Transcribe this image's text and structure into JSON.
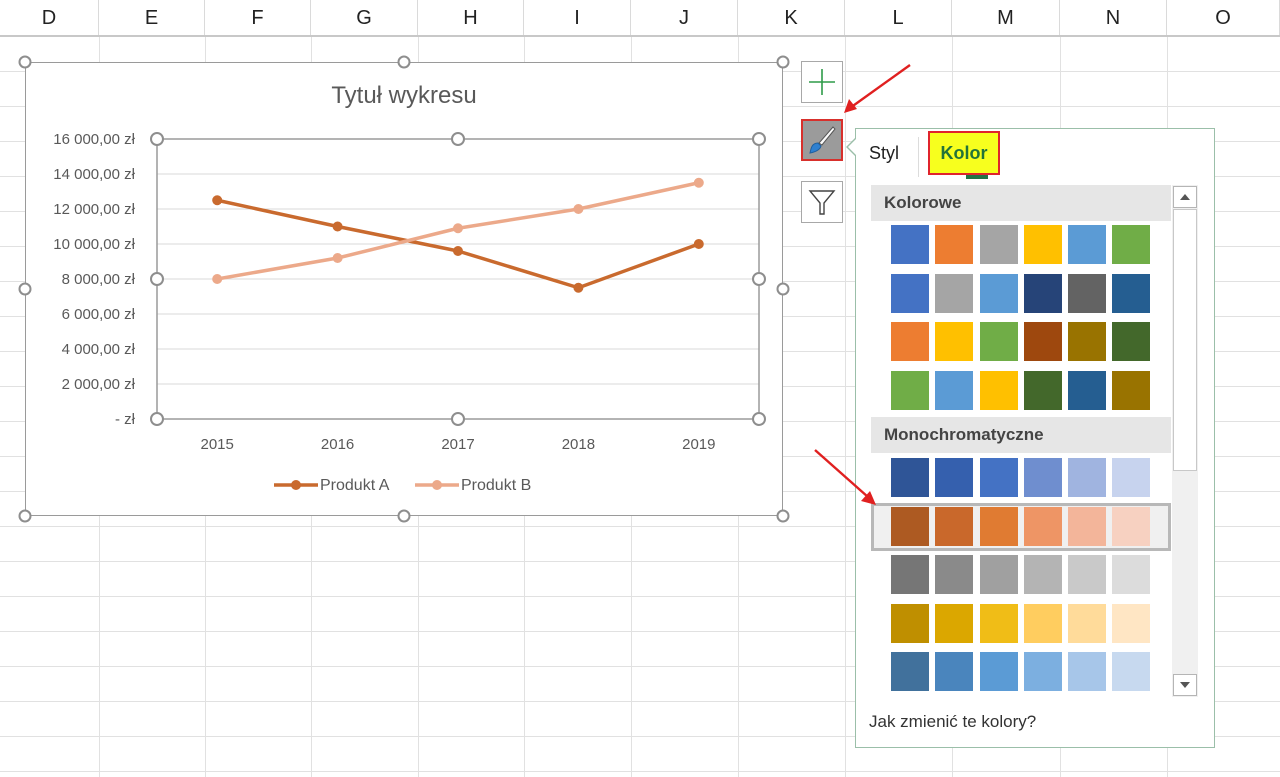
{
  "sheet": {
    "columns": [
      "D",
      "E",
      "F",
      "G",
      "H",
      "I",
      "J",
      "K",
      "L",
      "M",
      "N",
      "O"
    ]
  },
  "chart": {
    "title": "Tytuł wykresu"
  },
  "chart_data": {
    "type": "line",
    "title": "Tytuł wykresu",
    "categories": [
      "2015",
      "2016",
      "2017",
      "2018",
      "2019"
    ],
    "series": [
      {
        "name": "Produkt A",
        "color": "#c96a2e",
        "values": [
          12500,
          11000,
          9600,
          7500,
          10000
        ]
      },
      {
        "name": "Produkt B",
        "color": "#eca98a",
        "values": [
          8000,
          9200,
          10900,
          12000,
          13500
        ]
      }
    ],
    "ylim": [
      0,
      16000
    ],
    "yticks": [
      "-  zł",
      "2 000,00 zł",
      "4 000,00 zł",
      "6 000,00 zł",
      "8 000,00 zł",
      "10 000,00 zł",
      "12 000,00 zł",
      "14 000,00 zł",
      "16 000,00 zł"
    ],
    "grid": true,
    "legend_position": "bottom"
  },
  "side_buttons": {
    "elements_icon": "plus-icon",
    "styles_icon": "brush-icon",
    "filters_icon": "funnel-icon"
  },
  "panel": {
    "tab_style": "Styl",
    "tab_color": "Kolor",
    "group_colorful": "Kolorowe",
    "group_mono": "Monochromatyczne",
    "footer_link": "Jak zmienić te kolory?",
    "colorful_rows": [
      [
        "#4472c4",
        "#ed7d31",
        "#a5a5a5",
        "#ffc000",
        "#5b9bd5",
        "#70ad47"
      ],
      [
        "#4472c4",
        "#a5a5a5",
        "#5b9bd5",
        "#264478",
        "#636363",
        "#255e91"
      ],
      [
        "#ed7d31",
        "#ffc000",
        "#70ad47",
        "#9e480e",
        "#997300",
        "#43682b"
      ],
      [
        "#70ad47",
        "#5b9bd5",
        "#ffc000",
        "#43682b",
        "#255e91",
        "#997300"
      ]
    ],
    "mono_rows": [
      [
        "#2f5597",
        "#3560ae",
        "#4472c4",
        "#6f8ecf",
        "#a0b4e0",
        "#c7d3ee"
      ],
      [
        "#ad5a22",
        "#c9682b",
        "#e07b32",
        "#ee9565",
        "#f3b59a",
        "#f7d1c1"
      ],
      [
        "#767676",
        "#8a8a8a",
        "#a0a0a0",
        "#b4b4b4",
        "#c9c9c9",
        "#dcdcdc"
      ],
      [
        "#bf8f00",
        "#dba700",
        "#f0bd17",
        "#ffcd5f",
        "#ffdb9a",
        "#ffe6c4"
      ],
      [
        "#41719c",
        "#4a85bd",
        "#5b9bd5",
        "#7cafe0",
        "#a7c6e9",
        "#c7d9ef"
      ]
    ],
    "selected_mono_row": 1
  }
}
